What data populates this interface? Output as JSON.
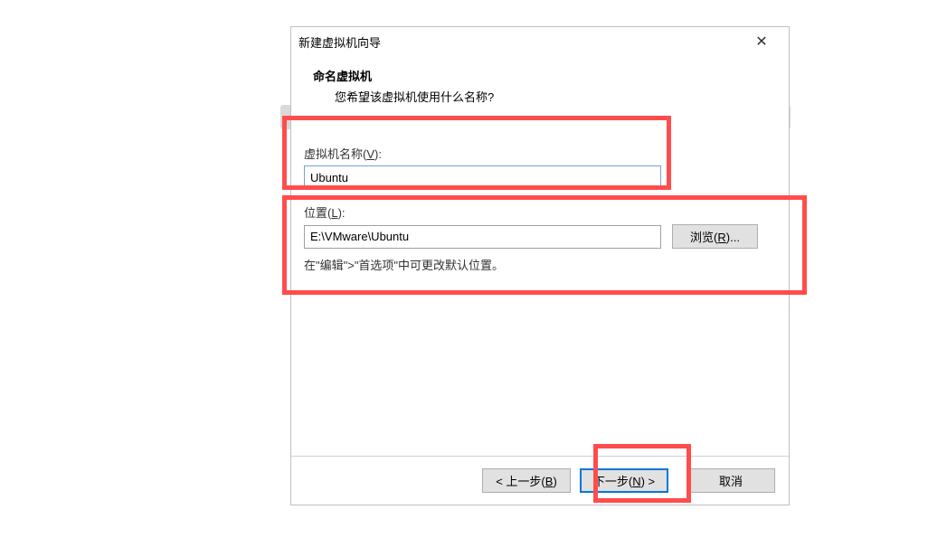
{
  "dialog": {
    "title": "新建虚拟机向导",
    "close_label": "✕"
  },
  "header": {
    "title": "命名虚拟机",
    "subtitle": "您希望该虚拟机使用什么名称?"
  },
  "fields": {
    "vm_name": {
      "label_prefix": "虚拟机名称(",
      "label_key": "V",
      "label_suffix": "):",
      "value": "Ubuntu"
    },
    "location": {
      "label_prefix": "位置(",
      "label_key": "L",
      "label_suffix": "):",
      "value": "E:\\VMware\\Ubuntu",
      "browse_prefix": "浏览(",
      "browse_key": "R",
      "browse_suffix": ")..."
    },
    "hint": "在\"编辑\">\"首选项\"中可更改默认位置。"
  },
  "footer": {
    "back_prefix": "< 上一步(",
    "back_key": "B",
    "back_suffix": ")",
    "next_prefix": "下一步(",
    "next_key": "N",
    "next_suffix": ") >",
    "cancel": "取消"
  }
}
